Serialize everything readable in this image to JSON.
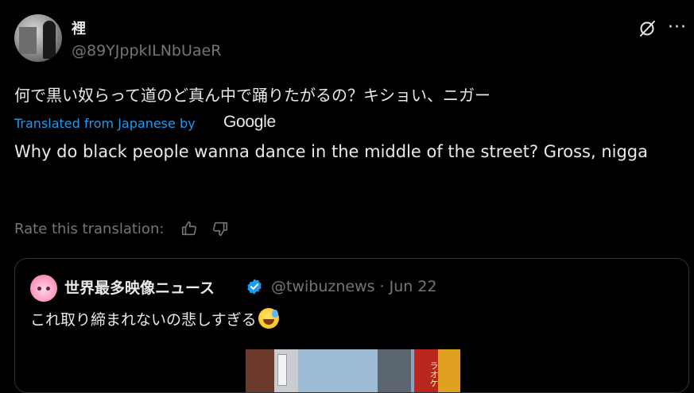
{
  "tweet": {
    "display_name": "裡",
    "handle": "@89YJppkILNbUaeR",
    "original_text": "何で黒い奴らって道のど真ん中で踊りたがるの？キショい、ニガー",
    "translated_from": "Translated from Japanese by",
    "google_logo_text": "Google",
    "translation_text": "Why do black people wanna dance in the middle of the street? Gross, nigga",
    "rate_label": "Rate this translation:"
  },
  "quote": {
    "display_name": "世界最多映像ニュース",
    "handle_date": "@twibuznews · Jun 22",
    "text": "これ取り締まれないの悲しすぎる",
    "media_sign_text": "ラオケ"
  },
  "colors": {
    "background": "#000000",
    "primary_text": "#e7e9ea",
    "secondary_text": "#71767b",
    "link_blue": "#1d9bf0",
    "border": "#2f3336"
  },
  "icons": {
    "grok": "grok-slash-circle-icon",
    "more": "more-horizontal-icon",
    "thumb_up": "thumb-up-icon",
    "thumb_down": "thumb-down-icon",
    "verified": "verified-badge-icon",
    "emoji": "sweat-smile-emoji"
  }
}
